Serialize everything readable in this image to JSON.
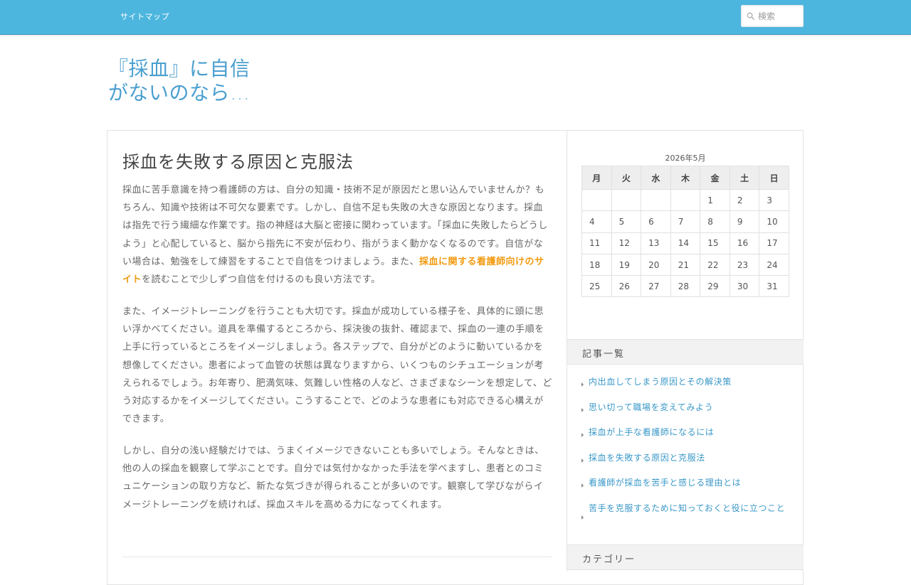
{
  "nav": {
    "sitemap_label": "サイトマップ"
  },
  "search": {
    "placeholder": "検索"
  },
  "site": {
    "title_line1": "『採血』に自信",
    "title_line2": "がないのなら…"
  },
  "article": {
    "title": "採血を失敗する原因と克服法",
    "p1_before": "採血に苦手意識を持つ看護師の方は、自分の知識・技術不足が原因だと思い込んでいませんか？もちろん、知識や技術は不可欠な要素です。しかし、自信不足も失敗の大きな原因となります。採血は指先で行う繊細な作業です。指の神経は大脳と密接に関わっています。「採血に失敗したらどうしよう」と心配していると、脳から指先に不安が伝わり、指がうまく動かなくなるのです。自信がない場合は、勉強をして練習をすることで自信をつけましょう。また、",
    "p1_link": "採血に関する看護師向けのサイト",
    "p1_after": "を読むことで少しずつ自信を付けるのも良い方法です。",
    "p2": "また、イメージトレーニングを行うことも大切です。採血が成功している様子を、具体的に頭に思い浮かべてください。道具を準備するところから、採決後の抜針、確認まで、採血の一連の手順を上手に行っているところをイメージしましょう。各ステップで、自分がどのように動いているかを想像してください。患者によって血管の状態は異なりますから、いくつものシチュエーションが考えられるでしょう。お年寄り、肥満気味、気難しい性格の人など、さまざまなシーンを想定して、どう対応するかをイメージしてください。こうすることで、どのような患者にも対応できる心構えができます。",
    "p3": "しかし、自分の浅い経験だけでは、うまくイメージできないことも多いでしょう。そんなときは、他の人の採血を観察して学ぶことです。自分では気付かなかった手法を学べますし、患者とのコミュニケーションの取り方など、新たな気づきが得られることが多いのです。観察して学びながらイメージトレーニングを続ければ、採血スキルを高める力になってくれます。"
  },
  "calendar": {
    "caption": "2026年5月",
    "weekdays": [
      "月",
      "火",
      "水",
      "木",
      "金",
      "土",
      "日"
    ],
    "rows": [
      [
        "",
        "",
        "",
        "",
        "1",
        "2",
        "3"
      ],
      [
        "4",
        "5",
        "6",
        "7",
        "8",
        "9",
        "10"
      ],
      [
        "11",
        "12",
        "13",
        "14",
        "15",
        "16",
        "17"
      ],
      [
        "18",
        "19",
        "20",
        "21",
        "22",
        "23",
        "24"
      ],
      [
        "25",
        "26",
        "27",
        "28",
        "29",
        "30",
        "31"
      ]
    ]
  },
  "recent": {
    "heading": "記事一覧",
    "items": [
      "内出血してしまう原因とその解決策",
      "思い切って職場を変えてみよう",
      "採血が上手な看護師になるには",
      "採血を失敗する原因と克服法",
      "看護師が採血を苦手と感じる理由とは",
      "苦手を克服するために知っておくと役に立つこと"
    ]
  },
  "categories": {
    "heading": "カテゴリー"
  },
  "colors": {
    "topbar": "#4db6de",
    "title": "#4a9fd0",
    "link_orange": "#f29a10",
    "sidebar_link": "#3a98c8"
  }
}
